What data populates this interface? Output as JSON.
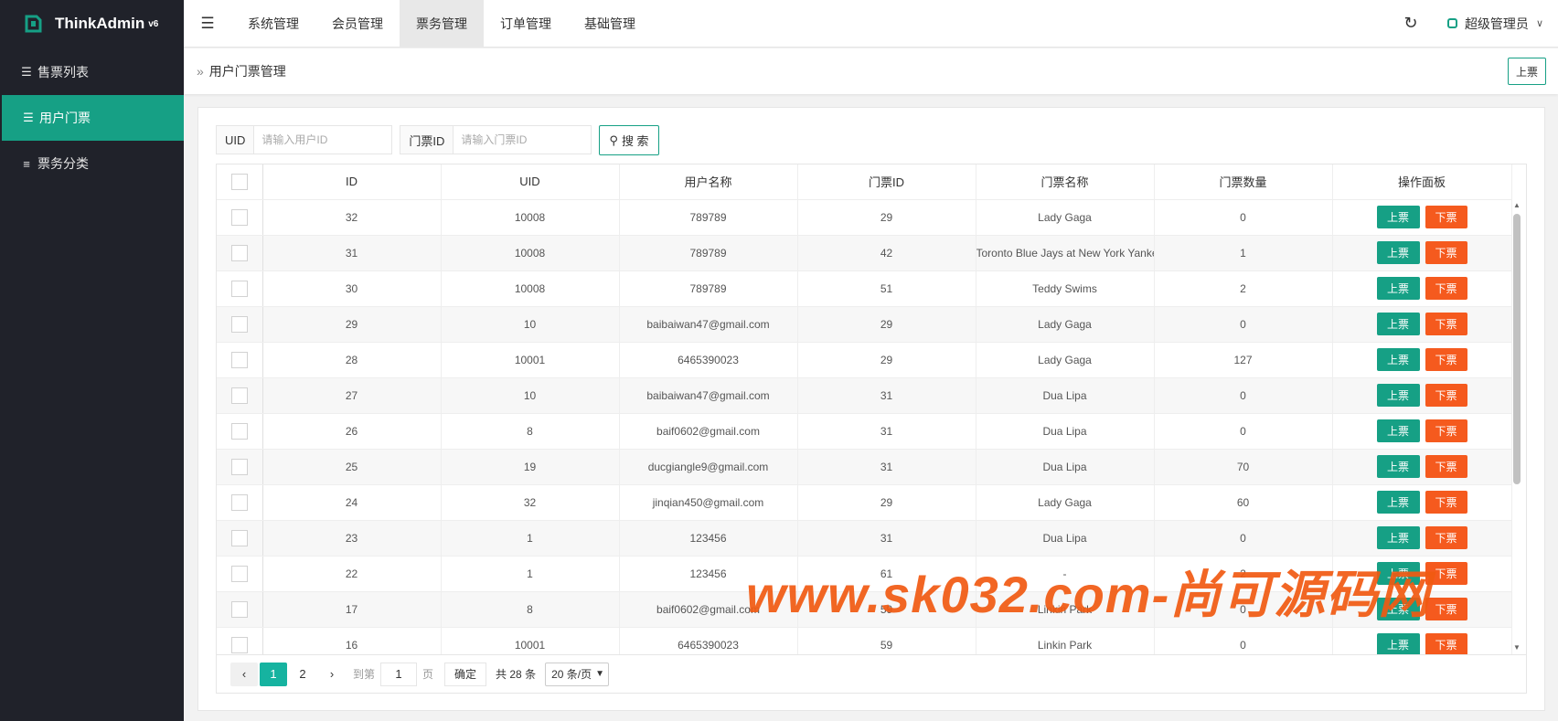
{
  "app": {
    "name": "ThinkAdmin",
    "version": "v6"
  },
  "sidebar": {
    "items": [
      {
        "label": "售票列表",
        "icon": "list-icon"
      },
      {
        "label": "用户门票",
        "icon": "list-icon"
      },
      {
        "label": "票务分类",
        "icon": "sliders-icon"
      }
    ],
    "active_index": 1
  },
  "header": {
    "nav": [
      "系统管理",
      "会员管理",
      "票务管理",
      "订单管理",
      "基础管理"
    ],
    "active_nav_index": 2,
    "user": "超级管理员"
  },
  "breadcrumb": {
    "title": "用户门票管理",
    "action_label": "上票"
  },
  "search": {
    "uid_label": "UID",
    "uid_placeholder": "请输入用户ID",
    "ticket_label": "门票ID",
    "ticket_placeholder": "请输入门票ID",
    "button_label": "搜 索"
  },
  "table": {
    "columns": [
      "ID",
      "UID",
      "用户名称",
      "门票ID",
      "门票名称",
      "门票数量",
      "操作面板"
    ],
    "up_label": "上票",
    "down_label": "下票",
    "rows": [
      [
        "32",
        "10008",
        "789789",
        "29",
        "Lady Gaga",
        "0"
      ],
      [
        "31",
        "10008",
        "789789",
        "42",
        "Toronto Blue Jays at New York Yankees",
        "1"
      ],
      [
        "30",
        "10008",
        "789789",
        "51",
        "Teddy Swims",
        "2"
      ],
      [
        "29",
        "10",
        "baibaiwan47@gmail.com",
        "29",
        "Lady Gaga",
        "0"
      ],
      [
        "28",
        "10001",
        "6465390023",
        "29",
        "Lady Gaga",
        "127"
      ],
      [
        "27",
        "10",
        "baibaiwan47@gmail.com",
        "31",
        "Dua Lipa",
        "0"
      ],
      [
        "26",
        "8",
        "baif0602@gmail.com",
        "31",
        "Dua Lipa",
        "0"
      ],
      [
        "25",
        "19",
        "ducgiangle9@gmail.com",
        "31",
        "Dua Lipa",
        "70"
      ],
      [
        "24",
        "32",
        "jinqian450@gmail.com",
        "29",
        "Lady Gaga",
        "60"
      ],
      [
        "23",
        "1",
        "123456",
        "31",
        "Dua Lipa",
        "0"
      ],
      [
        "22",
        "1",
        "123456",
        "61",
        "-",
        "2"
      ],
      [
        "17",
        "8",
        "baif0602@gmail.com",
        "59",
        "Linkin Park",
        "0"
      ],
      [
        "16",
        "10001",
        "6465390023",
        "59",
        "Linkin Park",
        "0"
      ]
    ]
  },
  "pagination": {
    "pages": [
      "1",
      "2"
    ],
    "current": "1",
    "goto_label": "到第",
    "goto_value": "1",
    "page_unit": "页",
    "confirm_label": "确定",
    "total_label": "共 28 条",
    "page_size": "20 条/页"
  },
  "watermark": {
    "text": "www.sk032.com-尚可源码网"
  },
  "colors": {
    "sidebar_bg": "#20222a",
    "accent": "#16a085",
    "danger": "#f55a1e",
    "watermark": "#f15a12"
  }
}
